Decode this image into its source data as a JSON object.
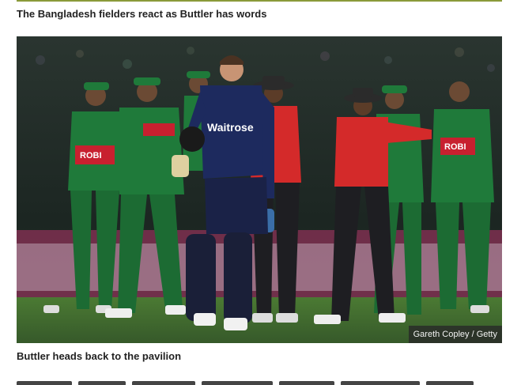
{
  "article": {
    "heading": "The Bangladesh fielders react as Buttler has words",
    "photo": {
      "credit": "Gareth Copley / Getty",
      "jersey_sponsor": "Waitrose",
      "bangladesh_jersey_sponsor": "ROBI"
    },
    "caption": "Buttler heads back to the pavilion"
  },
  "colors": {
    "accent_rule": "#8a9a3a",
    "bangladesh_green": "#1f7a3a",
    "bangladesh_red": "#c8202f",
    "england_navy": "#1d2a5e",
    "umpire_red": "#d42a2a",
    "outfield": "#3f6a2a"
  }
}
